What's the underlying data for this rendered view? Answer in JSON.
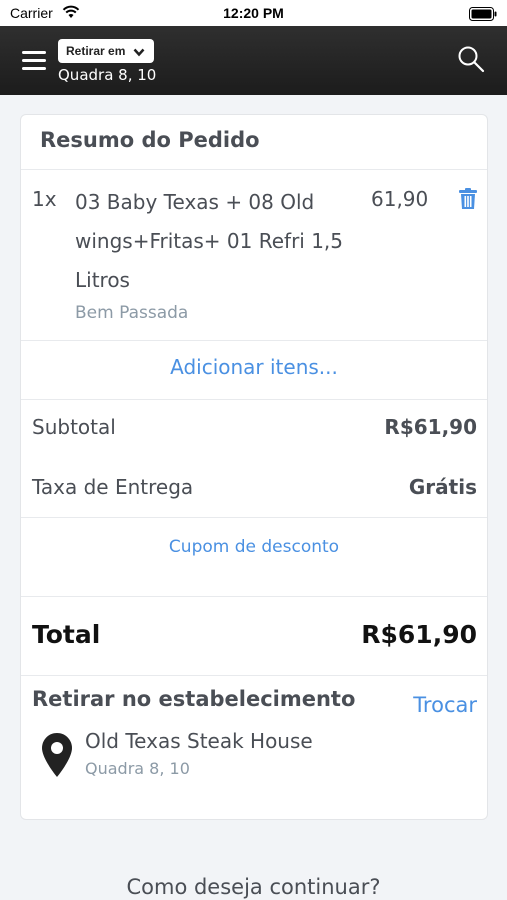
{
  "status_bar": {
    "carrier": "Carrier",
    "time": "12:20 PM"
  },
  "header": {
    "pickup_mode": "Retirar em",
    "address": "Quadra 8, 10",
    "icons": {
      "menu": "hamburger-icon",
      "search": "search-icon",
      "dropdown": "chevron-down-icon"
    }
  },
  "order_summary": {
    "title": "Resumo do Pedido",
    "items": [
      {
        "qty": "1x",
        "name": "03 Baby Texas + 08 Old wings+Fritas+ 01 Refri 1,5 Litros",
        "price": "61,90",
        "note": "Bem Passada"
      }
    ],
    "add_items_label": "Adicionar itens...",
    "subtotal_label": "Subtotal",
    "subtotal_value": "R$61,90",
    "delivery_fee_label": "Taxa de Entrega",
    "delivery_fee_value": "Grátis",
    "coupon_label": "Cupom de desconto",
    "total_label": "Total",
    "total_value": "R$61,90"
  },
  "pickup": {
    "title": "Retirar no estabelecimento",
    "swap_label": "Trocar",
    "store_name": "Old Texas Steak House",
    "store_address": "Quadra 8, 10"
  },
  "continue_prompt": "Como deseja continuar?",
  "colors": {
    "accent": "#4a90e2",
    "header_bg": "#222222",
    "background": "#f2f4f7"
  }
}
